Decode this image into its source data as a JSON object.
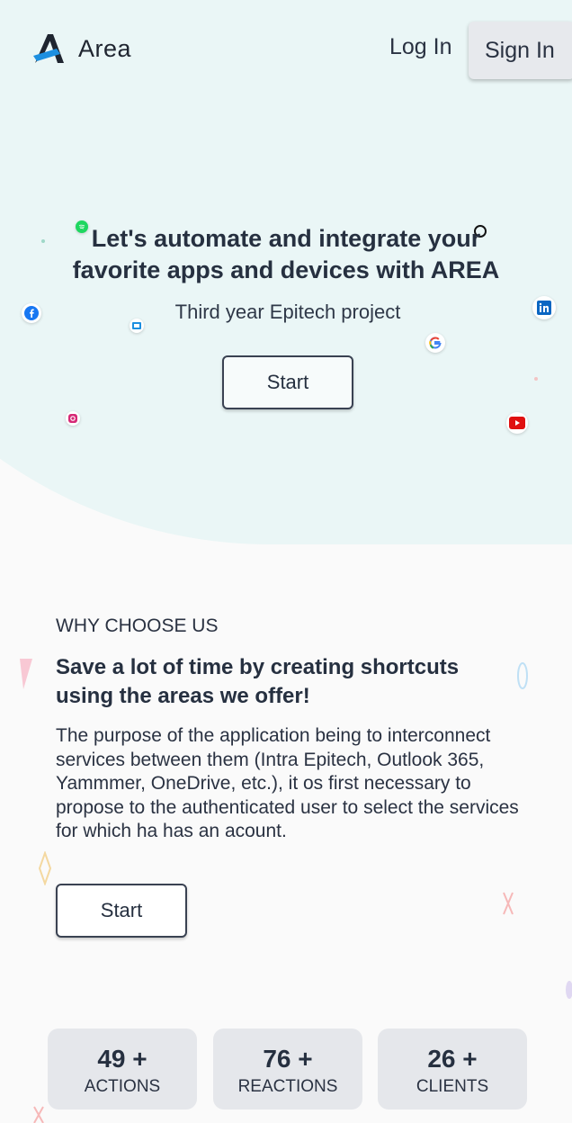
{
  "nav": {
    "brand": "Area",
    "login_label": "Log In",
    "signin_label": "Sign In"
  },
  "hero": {
    "title_line1": "Let's automate and integrate your",
    "title_line2": "favorite apps and devices with AREA",
    "subtitle": "Third year Epitech project",
    "start_label": "Start",
    "icons": [
      "facebook-icon",
      "outlook-icon",
      "instagram-icon",
      "google-icon",
      "linkedin-icon",
      "youtube-icon",
      "spotify-icon",
      "github-icon"
    ]
  },
  "why": {
    "label": "WHY CHOOSE US",
    "title": "Save a lot of time by creating shortcuts using the areas we offer!",
    "text": "The purpose of the application being to interconnect services between them (Intra Epitech, Outlook 365, Yammmer, OneDrive, etc.), it os first necessary to propose to the authenticated user to select the services for which ha has an acount.",
    "start_label": "Start"
  },
  "stats": [
    {
      "value": "49 +",
      "label": "ACTIONS"
    },
    {
      "value": "76 +",
      "label": "REACTIONS"
    },
    {
      "value": "26 +",
      "label": "CLIENTS"
    }
  ],
  "colors": {
    "hero_bg": "#eaf6f6",
    "page_bg": "#fafafa",
    "text": "#263040",
    "stat_bg": "#e5e7eb",
    "logo_blue": "#1c8fe0"
  }
}
